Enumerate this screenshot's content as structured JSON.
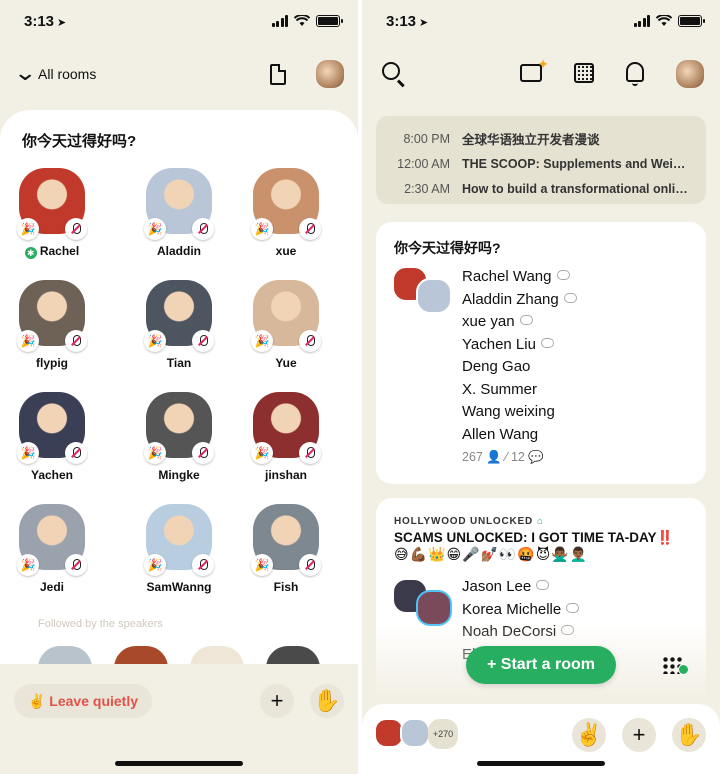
{
  "status": {
    "time": "3:13",
    "location_glyph": "➤"
  },
  "left": {
    "header": {
      "back_label": "All rooms"
    },
    "room_title": "你今天过得好吗?",
    "speakers": [
      {
        "name": "Rachel",
        "moderator": true,
        "color": "#c0392b"
      },
      {
        "name": "Aladdin",
        "moderator": false,
        "color": "#b8c6d8"
      },
      {
        "name": "xue",
        "moderator": false,
        "color": "#c9916c"
      },
      {
        "name": "flypig",
        "moderator": false,
        "color": "#6e6257"
      },
      {
        "name": "Tian",
        "moderator": false,
        "color": "#4c5560"
      },
      {
        "name": "Yue",
        "moderator": false,
        "color": "#d8b89a"
      },
      {
        "name": "Yachen",
        "moderator": false,
        "color": "#3b3f55"
      },
      {
        "name": "Mingke",
        "moderator": false,
        "color": "#555555"
      },
      {
        "name": "jinshan",
        "moderator": false,
        "color": "#8e2f2f"
      },
      {
        "name": "Jedi",
        "moderator": false,
        "color": "#9aa3ad"
      },
      {
        "name": "SamWanng",
        "moderator": false,
        "color": "#b8cde0"
      },
      {
        "name": "Fish",
        "moderator": false,
        "color": "#7e8890"
      }
    ],
    "followed_label": "Followed by the speakers",
    "followed_colors": [
      "#b9c3cc",
      "#a84a2a",
      "#f0e6d8",
      "#4a4a4a"
    ],
    "leave_label": "✌️ Leave quietly",
    "plus_glyph": "+",
    "hand_glyph": "✋"
  },
  "right": {
    "upcoming": [
      {
        "time": "8:00 PM",
        "title": "全球华语独立开发者漫谈"
      },
      {
        "time": "12:00 AM",
        "title": "THE SCOOP: Supplements and Weig..."
      },
      {
        "time": "2:30 AM",
        "title": "How to build a transformational onlin..."
      }
    ],
    "room1": {
      "title": "你今天过得好吗?",
      "speakers": [
        "Rachel Wang",
        "Aladdin Zhang",
        "xue yan",
        "Yachen Liu",
        "Deng Gao",
        "X. Summer",
        "Wang weixing",
        "Allen Wang"
      ],
      "with_bubble": [
        true,
        true,
        true,
        true,
        false,
        false,
        false,
        false
      ],
      "listeners": "267",
      "speaker_count": "12"
    },
    "room2": {
      "club": "HOLLYWOOD UNLOCKED",
      "title": "SCAMS UNLOCKED: I GOT TIME TA-DAY‼️",
      "emojis": "😅💪🏾👑😁🎤💅🏽👀🤬😈🙅🏾‍♂️👨🏾‍🦱",
      "speakers": [
        "Jason Lee",
        "Korea Michelle",
        "Noah DeCorsi",
        "El"
      ]
    },
    "start_room_label": "+ Start a room",
    "hallway_count": "+270",
    "wave_glyph": "✌️",
    "plus_glyph": "+",
    "hand_glyph": "✋"
  },
  "colors": {
    "accent_green": "#27ae60",
    "leave_red": "#e0524a",
    "background": "#f2efe4"
  }
}
